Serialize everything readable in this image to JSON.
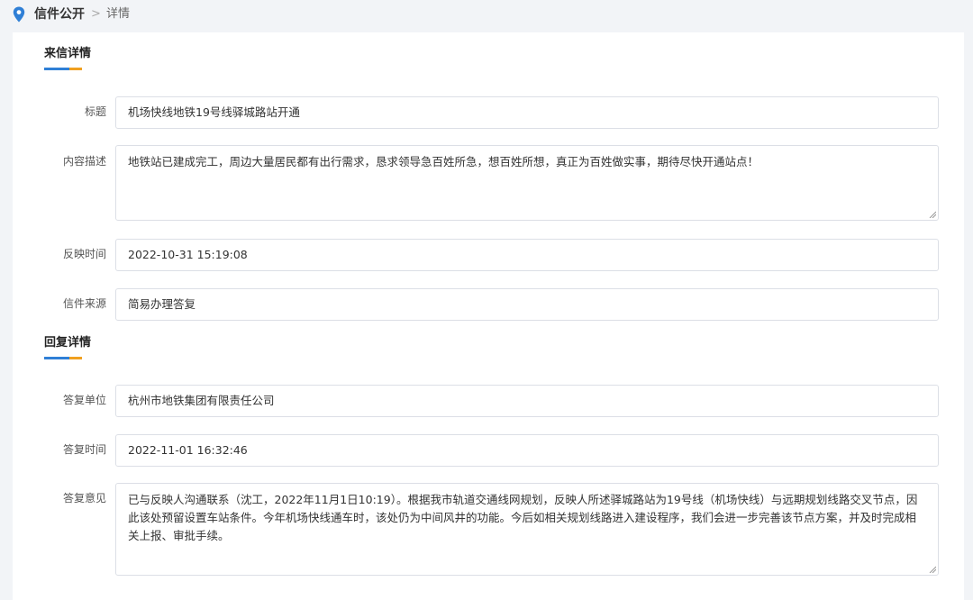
{
  "breadcrumb": {
    "root": "信件公开",
    "separator": ">",
    "current": "详情"
  },
  "letter_section": {
    "title": "来信详情",
    "fields": {
      "title": {
        "label": "标题",
        "value": "机场快线地铁19号线驿城路站开通"
      },
      "description": {
        "label": "内容描述",
        "value": "地铁站已建成完工，周边大量居民都有出行需求，恳求领导急百姓所急，想百姓所想，真正为百姓做实事，期待尽快开通站点！"
      },
      "time": {
        "label": "反映时间",
        "value": "2022-10-31 15:19:08"
      },
      "source": {
        "label": "信件来源",
        "value": "简易办理答复"
      }
    }
  },
  "reply_section": {
    "title": "回复详情",
    "fields": {
      "unit": {
        "label": "答复单位",
        "value": "杭州市地铁集团有限责任公司"
      },
      "time": {
        "label": "答复时间",
        "value": "2022-11-01 16:32:46"
      },
      "opinion": {
        "label": "答复意见",
        "value": "已与反映人沟通联系（沈工，2022年11月1日10:19）。根据我市轨道交通线网规划，反映人所述驿城路站为19号线（机场快线）与远期规划线路交叉节点，因此该处预留设置车站条件。今年机场快线通车时，该处仍为中间风井的功能。今后如相关规划线路进入建设程序，我们会进一步完善该节点方案，并及时完成相关上报、审批手续。"
      }
    }
  },
  "colors": {
    "accent_blue": "#2f7fd6",
    "accent_orange": "#f0a020",
    "border": "#dcdfe6",
    "background": "#f2f4f7"
  },
  "icons": {
    "breadcrumb": "location-pin-icon"
  }
}
